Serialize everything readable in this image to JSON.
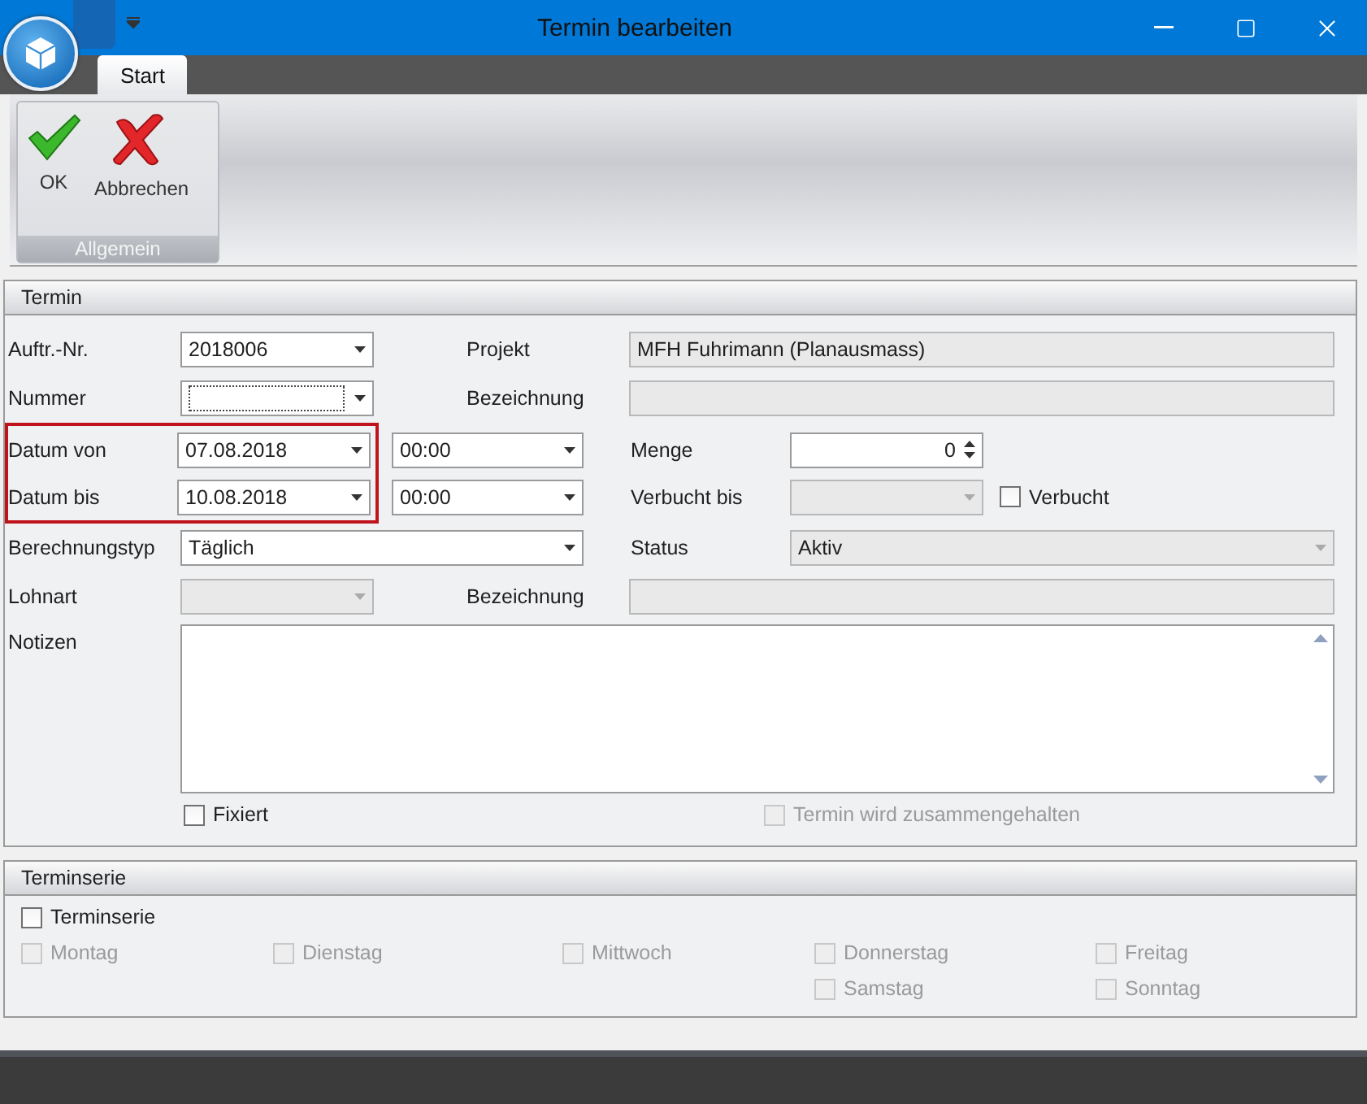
{
  "window": {
    "title": "Termin bearbeiten"
  },
  "tabs": [
    {
      "label": "Start",
      "selected": true
    }
  ],
  "ribbon": {
    "group_label": "Allgemein",
    "buttons": [
      {
        "label": "OK",
        "kind": "ok"
      },
      {
        "label": "Abbrechen",
        "kind": "cancel"
      }
    ]
  },
  "termin": {
    "title": "Termin",
    "auftrag": {
      "label": "Auftr.-Nr.",
      "value": "2018006"
    },
    "projekt": {
      "label": "Projekt",
      "value": "MFH Fuhrimann (Planausmass)"
    },
    "nummer": {
      "label": "Nummer",
      "focused": true
    },
    "bezeichnung": {
      "label": "Bezeichnung"
    },
    "date_range_highlighted": true,
    "datum_von": {
      "label": "Datum von",
      "date": "07.08.2018",
      "time": "00:00"
    },
    "datum_bis": {
      "label": "Datum bis",
      "date": "10.08.2018",
      "time": "00:00"
    },
    "menge": {
      "label": "Menge",
      "value": "0"
    },
    "verbucht_bis": {
      "label": "Verbucht bis",
      "disabled": true
    },
    "verbucht": {
      "label": "Verbucht",
      "checked": false
    },
    "berechnungstyp": {
      "label": "Berechnungstyp",
      "value": "Täglich"
    },
    "status": {
      "label": "Status",
      "value": "Aktiv",
      "disabled": true
    },
    "lohnart": {
      "label": "Lohnart",
      "disabled": true
    },
    "lohnart_bezeichnung": {
      "label": "Bezeichnung"
    },
    "notizen": {
      "label": "Notizen"
    },
    "fixiert": {
      "label": "Fixiert",
      "checked": false,
      "disabled": false
    },
    "zusammengehalten": {
      "label": "Termin wird zusammengehalten",
      "checked": false,
      "disabled": true
    }
  },
  "terminserie": {
    "title": "Terminserie",
    "toggle": {
      "label": "Terminserie",
      "checked": false
    },
    "days": [
      {
        "label": "Montag",
        "checked": false,
        "disabled": true
      },
      {
        "label": "Dienstag",
        "checked": false,
        "disabled": true
      },
      {
        "label": "Mittwoch",
        "checked": false,
        "disabled": true
      },
      {
        "label": "Donnerstag",
        "checked": false,
        "disabled": true
      },
      {
        "label": "Freitag",
        "checked": false,
        "disabled": true
      },
      {
        "label": "Samstag",
        "checked": false,
        "disabled": true
      },
      {
        "label": "Sonntag",
        "checked": false,
        "disabled": true
      }
    ]
  }
}
